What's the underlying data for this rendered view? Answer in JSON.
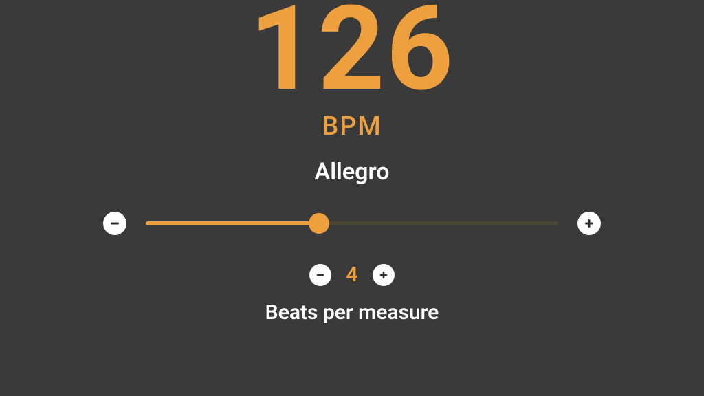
{
  "bpm": {
    "value": "126",
    "unit_label": "BPM"
  },
  "tempo": {
    "name": "Allegro"
  },
  "slider": {
    "fill_percent": 42
  },
  "beats": {
    "value": "4",
    "label": "Beats per measure"
  },
  "colors": {
    "accent": "#eea03f",
    "background": "#3a3a3a"
  }
}
